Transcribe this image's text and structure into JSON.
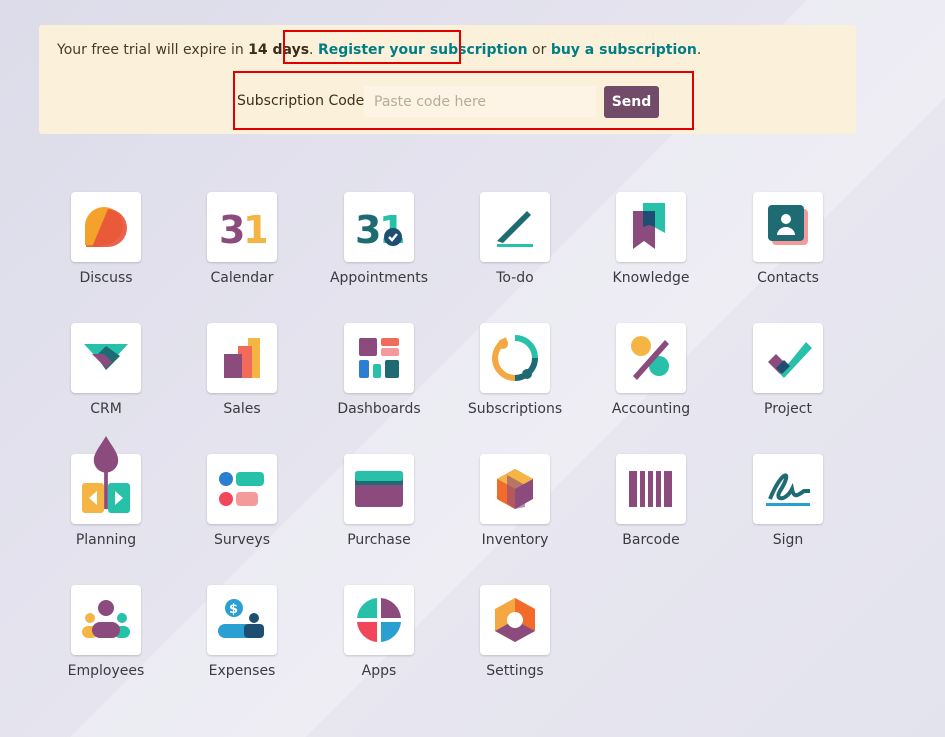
{
  "banner": {
    "trial_prefix": "Your free trial will expire in ",
    "trial_days": "14 days",
    "register_link": "Register your subscription",
    "or_text": " or ",
    "buy_link": "buy a subscription",
    "period": ".",
    "code_label": "Subscription Code:",
    "code_placeholder": "Paste code here",
    "send_label": "Send"
  },
  "apps": [
    {
      "label": "Discuss",
      "icon": "discuss-icon"
    },
    {
      "label": "Calendar",
      "icon": "calendar-icon"
    },
    {
      "label": "Appointments",
      "icon": "appointments-icon"
    },
    {
      "label": "To-do",
      "icon": "todo-icon"
    },
    {
      "label": "Knowledge",
      "icon": "knowledge-icon"
    },
    {
      "label": "Contacts",
      "icon": "contacts-icon"
    },
    {
      "label": "CRM",
      "icon": "crm-icon"
    },
    {
      "label": "Sales",
      "icon": "sales-icon"
    },
    {
      "label": "Dashboards",
      "icon": "dashboards-icon"
    },
    {
      "label": "Subscriptions",
      "icon": "subscriptions-icon"
    },
    {
      "label": "Accounting",
      "icon": "accounting-icon"
    },
    {
      "label": "Project",
      "icon": "project-icon"
    },
    {
      "label": "Planning",
      "icon": "planning-icon"
    },
    {
      "label": "Surveys",
      "icon": "surveys-icon"
    },
    {
      "label": "Purchase",
      "icon": "purchase-icon"
    },
    {
      "label": "Inventory",
      "icon": "inventory-icon"
    },
    {
      "label": "Barcode",
      "icon": "barcode-icon"
    },
    {
      "label": "Sign",
      "icon": "sign-icon"
    },
    {
      "label": "Employees",
      "icon": "employees-icon"
    },
    {
      "label": "Expenses",
      "icon": "expenses-icon"
    },
    {
      "label": "Apps",
      "icon": "apps-icon"
    },
    {
      "label": "Settings",
      "icon": "settings-icon"
    }
  ],
  "colors": {
    "primary": "#714b67",
    "link": "#017e84",
    "banner_bg": "#fbf0d9",
    "highlight": "#e00000"
  }
}
